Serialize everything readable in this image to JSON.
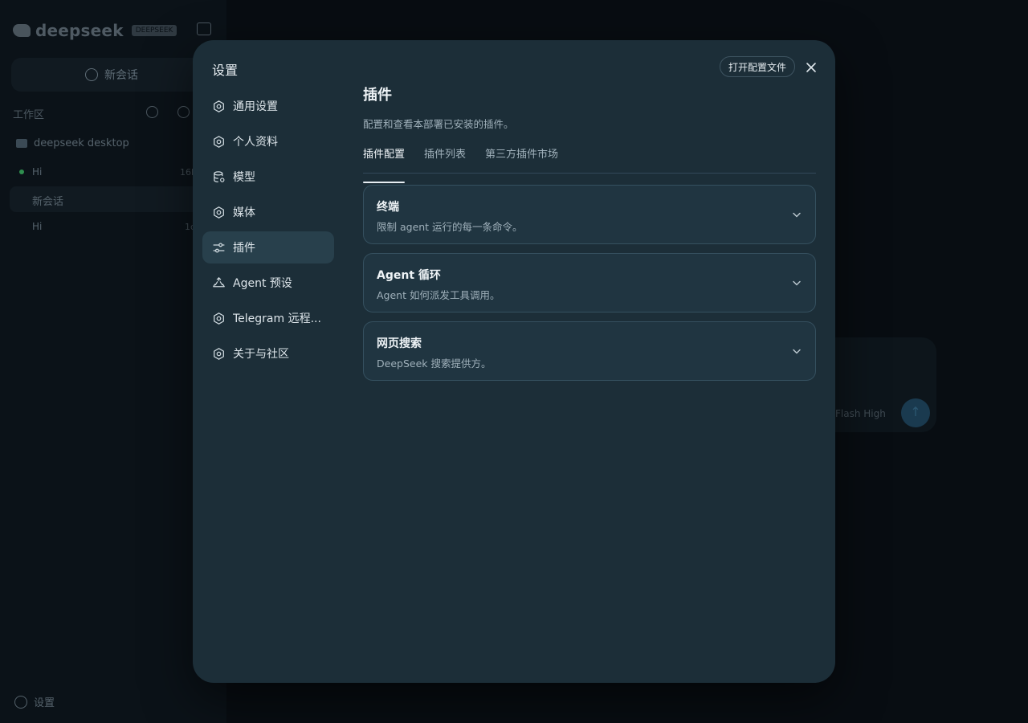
{
  "background": {
    "brand": "deepseek",
    "brand_tag": "DEEPSEEK",
    "new_chat": "新会话",
    "workspace_label": "工作区",
    "folder": "deepseek desktop",
    "chat_1": "Hi",
    "chat_1_time": "16h",
    "selected_chat": "新会话",
    "chat_2": "Hi",
    "chat_2_time": "1d",
    "settings": "设置",
    "model_selector": "Flash High"
  },
  "modal": {
    "title": "设置",
    "open_config_label": "打开配置文件",
    "nav": [
      {
        "label": "通用设置",
        "icon": "gear-icon"
      },
      {
        "label": "个人资料",
        "icon": "gear-icon"
      },
      {
        "label": "模型",
        "icon": "database-icon"
      },
      {
        "label": "媒体",
        "icon": "gear-icon"
      },
      {
        "label": "插件",
        "icon": "sliders-icon"
      },
      {
        "label": "Agent 预设",
        "icon": "recycle-icon"
      },
      {
        "label": "Telegram 远程...",
        "icon": "gear-icon"
      },
      {
        "label": "关于与社区",
        "icon": "gear-icon"
      }
    ],
    "active_nav": "插件",
    "content": {
      "title": "插件",
      "description": "配置和查看本部署已安装的插件。",
      "tabs": [
        "插件配置",
        "插件列表",
        "第三方插件市场"
      ],
      "active_tab": "插件配置",
      "cards": [
        {
          "title": "终端",
          "subtitle": "限制 agent 运行的每一条命令。"
        },
        {
          "title": "Agent 循环",
          "subtitle": "Agent 如何派发工具调用。"
        },
        {
          "title": "网页搜索",
          "subtitle": "DeepSeek 搜索提供方。"
        }
      ]
    }
  },
  "colors": {
    "backdrop": "#080d12",
    "modal_bg": "#1c2e38",
    "active_nav_bg": "#28404c",
    "card_bg": "#203541",
    "card_border": "#35505f"
  }
}
